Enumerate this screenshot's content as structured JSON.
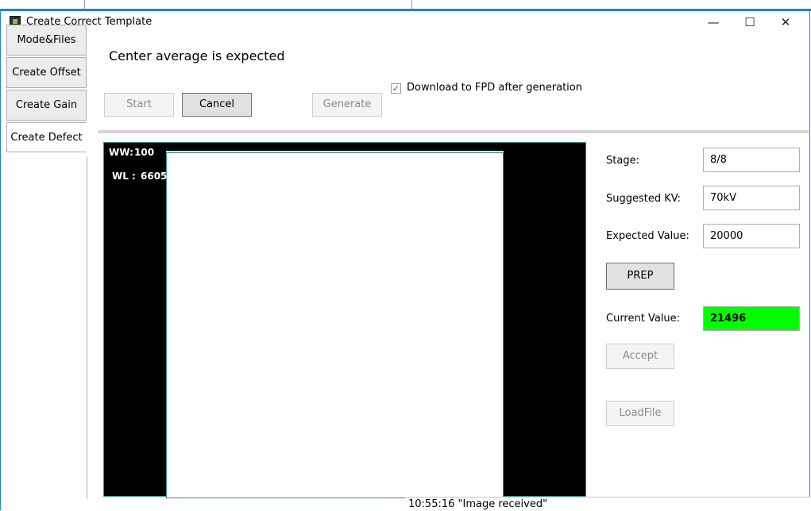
{
  "window": {
    "title": "Create Correct Template",
    "minimize": "—",
    "maximize": "☐",
    "close": "✕"
  },
  "tabs": [
    "Mode&Files",
    "Create Offset",
    "Create Gain",
    "Create Defect"
  ],
  "headline": "Center average is expected",
  "buttons": {
    "start": "Start",
    "cancel": "Cancel",
    "generate": "Generate",
    "prep": "PREP",
    "accept": "Accept",
    "loadfile": "LoadFile"
  },
  "download": {
    "checked": true,
    "label": "Download to FPD after generation"
  },
  "viewer": {
    "ww_label": "WW:",
    "ww_value": "100",
    "wl_label": "WL :",
    "wl_value": "6605"
  },
  "params": {
    "stage_label": "Stage:",
    "stage_value": "8/8",
    "kv_label": "Suggested KV:",
    "kv_value": "70kV",
    "expected_label": "Expected Value:",
    "expected_value": "20000",
    "current_label": "Current Value:",
    "current_value": "21496"
  },
  "status": "10:55:16 \"Image received\"",
  "colors": {
    "current_value_bg": "#00ff00",
    "window_border": "#1c86d1"
  }
}
